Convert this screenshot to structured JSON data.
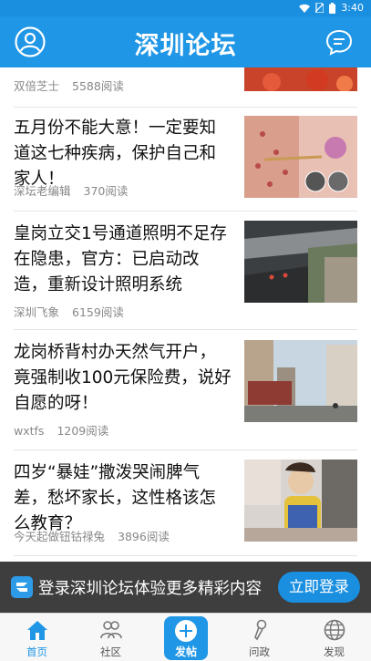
{
  "status": {
    "time": "3:40"
  },
  "header": {
    "title": "深圳论坛"
  },
  "feed": {
    "items": [
      {
        "title": "",
        "author": "双倍芝士",
        "reads": "5588阅读"
      },
      {
        "title": "五月份不能大意！一定要知道这七种疾病，保护自己和家人！",
        "author": "深坛老编辑",
        "reads": "370阅读"
      },
      {
        "title": "皇岗立交1号通道照明不足存在隐患，官方：已启动改造，重新设计照明系统",
        "author": "深圳飞象",
        "reads": "6159阅读"
      },
      {
        "title": "龙岗桥背村办天然气开户，竟强制收100元保险费，说好自愿的呀！",
        "author": "wxtfs",
        "reads": "1209阅读"
      },
      {
        "title": "四岁“暴娃”撒泼哭闹脾气差，愁坏家长，这性格该怎么教育？",
        "author": "今天起做钮钴禄兔",
        "reads": "3896阅读"
      },
      {
        "title": "",
        "author": "",
        "reads": ""
      }
    ]
  },
  "banner": {
    "text": "登录深圳论坛体验更多精彩内容",
    "button": "立即登录"
  },
  "tabbar": {
    "home": "首页",
    "community": "社区",
    "post": "发帖",
    "politics": "问政",
    "discover": "发现"
  },
  "colors": {
    "brand": "#1f96e6",
    "status_bar": "#1a8fe0"
  }
}
